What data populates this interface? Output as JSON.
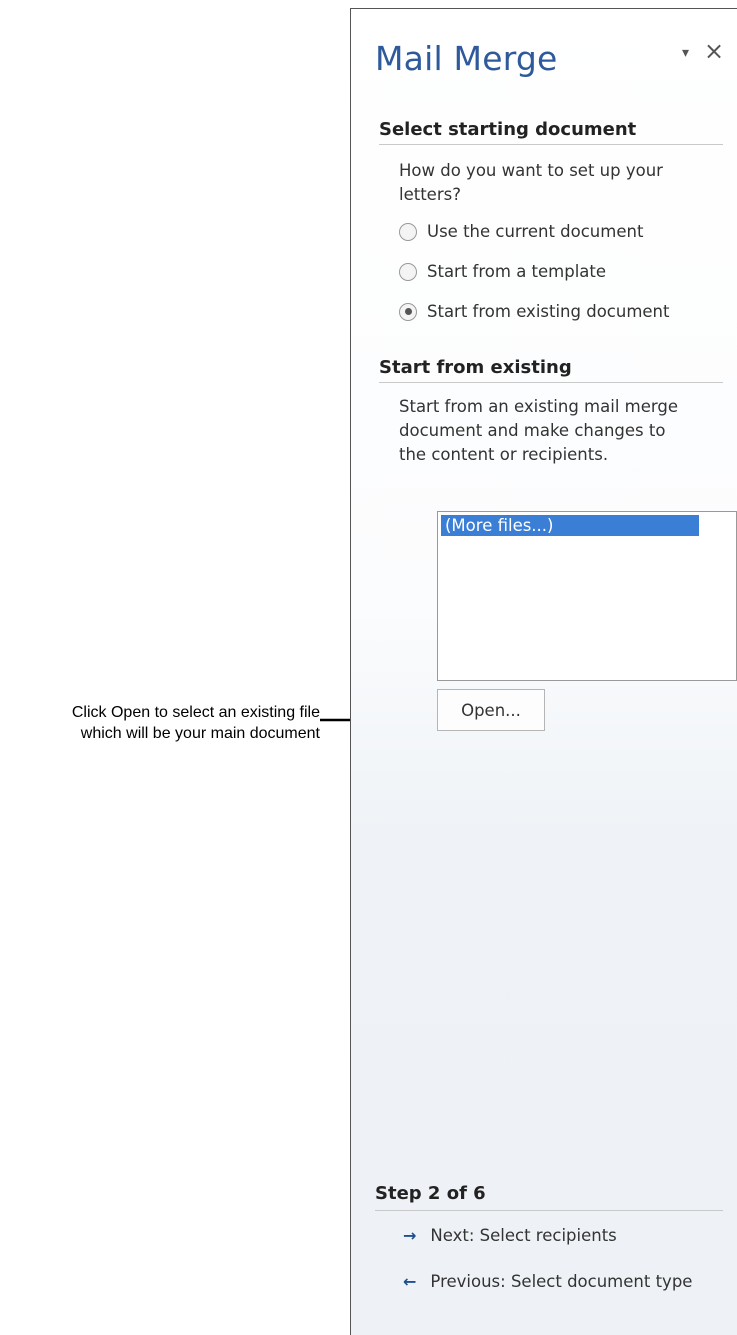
{
  "callout": {
    "line1": "Click Open to select an existing file",
    "line2": "which will be your main document"
  },
  "pane": {
    "title": "Mail Merge",
    "menu_icon": "▾",
    "close_icon": "×"
  },
  "select_starting": {
    "heading": "Select starting document",
    "question": "How do you want to set up your letters?",
    "options": [
      {
        "label": "Use the current document",
        "selected": false
      },
      {
        "label": "Start from a template",
        "selected": false
      },
      {
        "label": "Start from existing document",
        "selected": true
      }
    ]
  },
  "start_existing": {
    "heading": "Start from existing",
    "description": "Start from an existing mail merge document and make changes to the content or recipients.",
    "files": [
      "(More files...)"
    ],
    "open_label": "Open..."
  },
  "step": {
    "heading": "Step 2 of 6",
    "next_label": "Next: Select recipients",
    "previous_label": "Previous: Select document type"
  }
}
